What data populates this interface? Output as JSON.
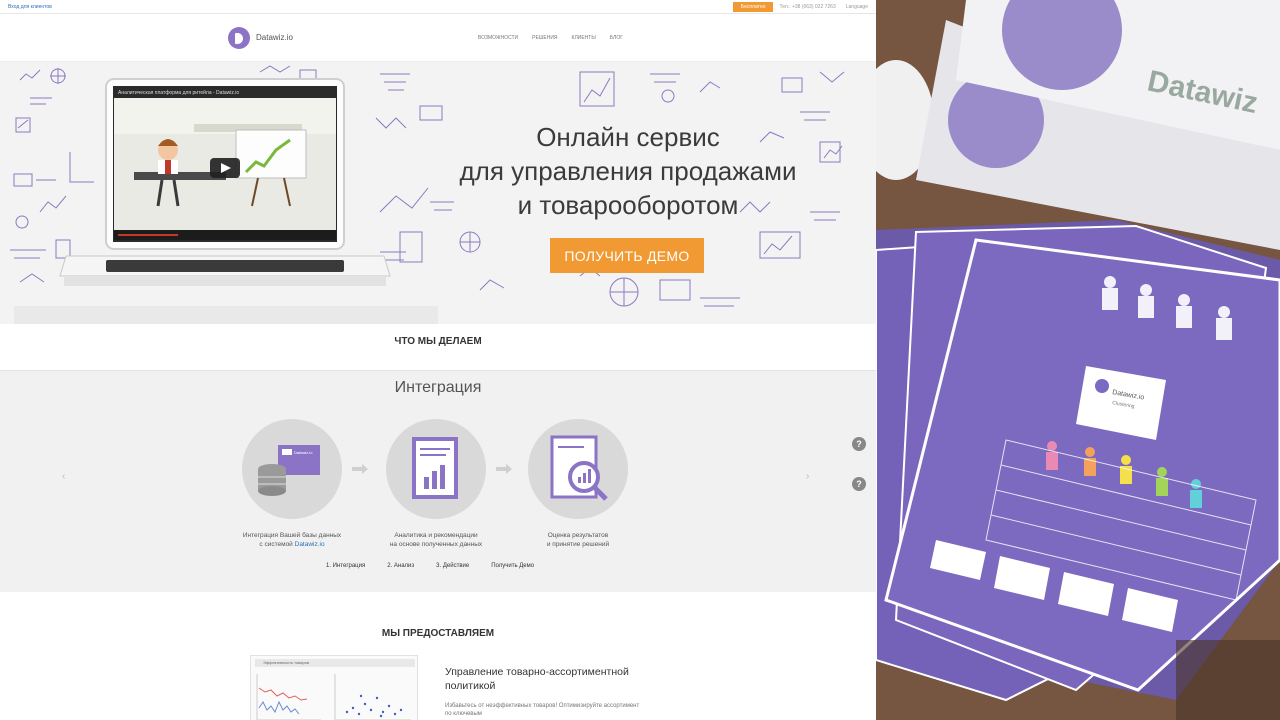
{
  "topbar": {
    "client_login": "Вход для клиентов",
    "call_button": "Бесплатно",
    "phone": "Тел.: +38 (063) 022 7263",
    "language": "Language"
  },
  "header": {
    "logo_text": "Datawiz.io",
    "nav": [
      "Возможности",
      "Решения",
      "Клиенты",
      "Блог"
    ]
  },
  "hero": {
    "title_lines": [
      "Онлайн сервис",
      "для управления продажами",
      "и товарооборотом"
    ],
    "demo_button": "ПОЛУЧИТЬ ДЕМО",
    "video_title": "Аналитическая платформа для ритейла - Datawiz.io"
  },
  "what_we_do": {
    "title": "ЧТО МЫ ДЕЛАЕМ"
  },
  "integration": {
    "title": "Интеграция",
    "steps": [
      {
        "caption_line1": "Интеграция Вашей базы данных",
        "caption_prefix": "с системой ",
        "caption_link": "Datawiz.io"
      },
      {
        "caption_line1": "Аналитика и рекомендации",
        "caption_line2": "на основе полученных данных"
      },
      {
        "caption_line1": "Оценка результатов",
        "caption_line2": "и принятие решений"
      }
    ],
    "tabs": [
      "1. Интеграция",
      "2. Анализ",
      "3. Действие",
      "Получить Демо"
    ],
    "mini_logo": "Datawiz.io"
  },
  "provide": {
    "title": "МЫ ПРЕДОСТАВЛЯЕМ",
    "chart_header": "Эффективность товаров",
    "heading": "Управление товарно-ассортиментной политикой",
    "text": "Избавьтесь от неэффективных товаров! Оптимизируйте ассортимент по ключевым"
  },
  "photo": {
    "card_text": "Datawiz",
    "flyer_brand": "Datawiz.io",
    "flyer_sub": "Clustering"
  },
  "colors": {
    "accent_orange": "#f19a33",
    "brand_purple": "#8b74c5",
    "link_blue": "#2a6fb8"
  }
}
